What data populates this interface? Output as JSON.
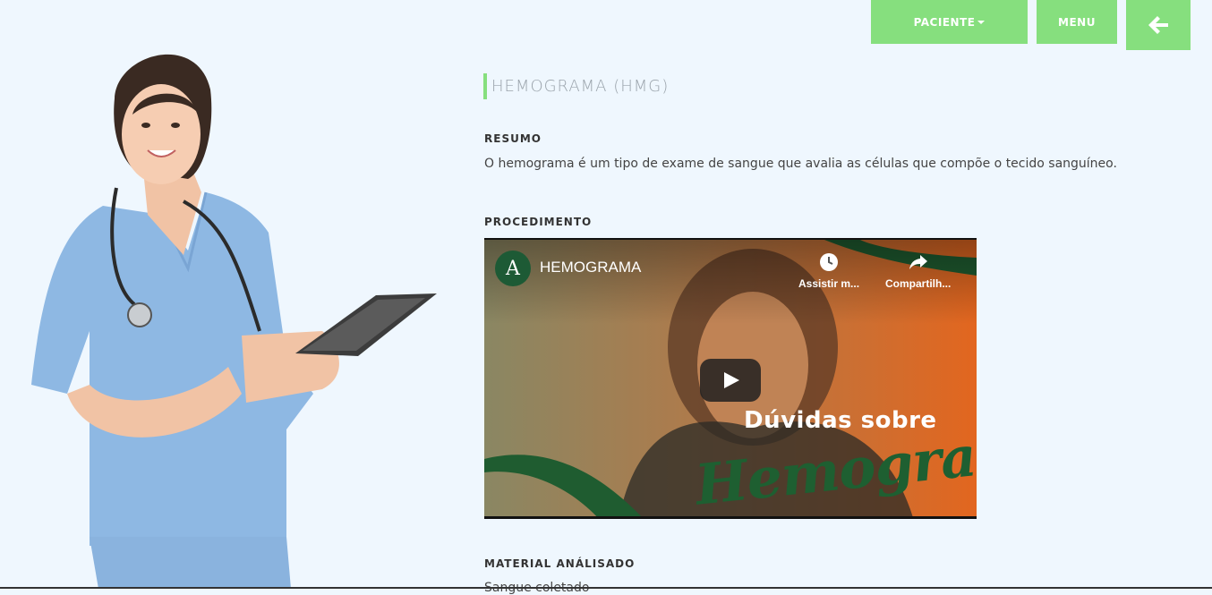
{
  "nav": {
    "paciente_label": "PACIENTE",
    "menu_label": "MENU",
    "back_icon": "arrow-left-icon"
  },
  "exam": {
    "title": "HEMOGRAMA (HMG)",
    "resumo_label": "RESUMO",
    "resumo_text": "O hemograma é um tipo de exame de sangue que avalia as células que compõe o tecido sanguíneo.",
    "procedimento_label": "PROCEDIMENTO",
    "material_label": "MATERIAL ANÁLISADO",
    "material_text": "Sangue coletado"
  },
  "video": {
    "title": "HEMOGRAMA",
    "watch_later": "Assistir m...",
    "share": "Compartilh...",
    "overlay_line1": "Dúvidas sobre",
    "overlay_line2": "Hemograma"
  },
  "colors": {
    "accent": "#86df7e",
    "background": "#eff7fe"
  }
}
